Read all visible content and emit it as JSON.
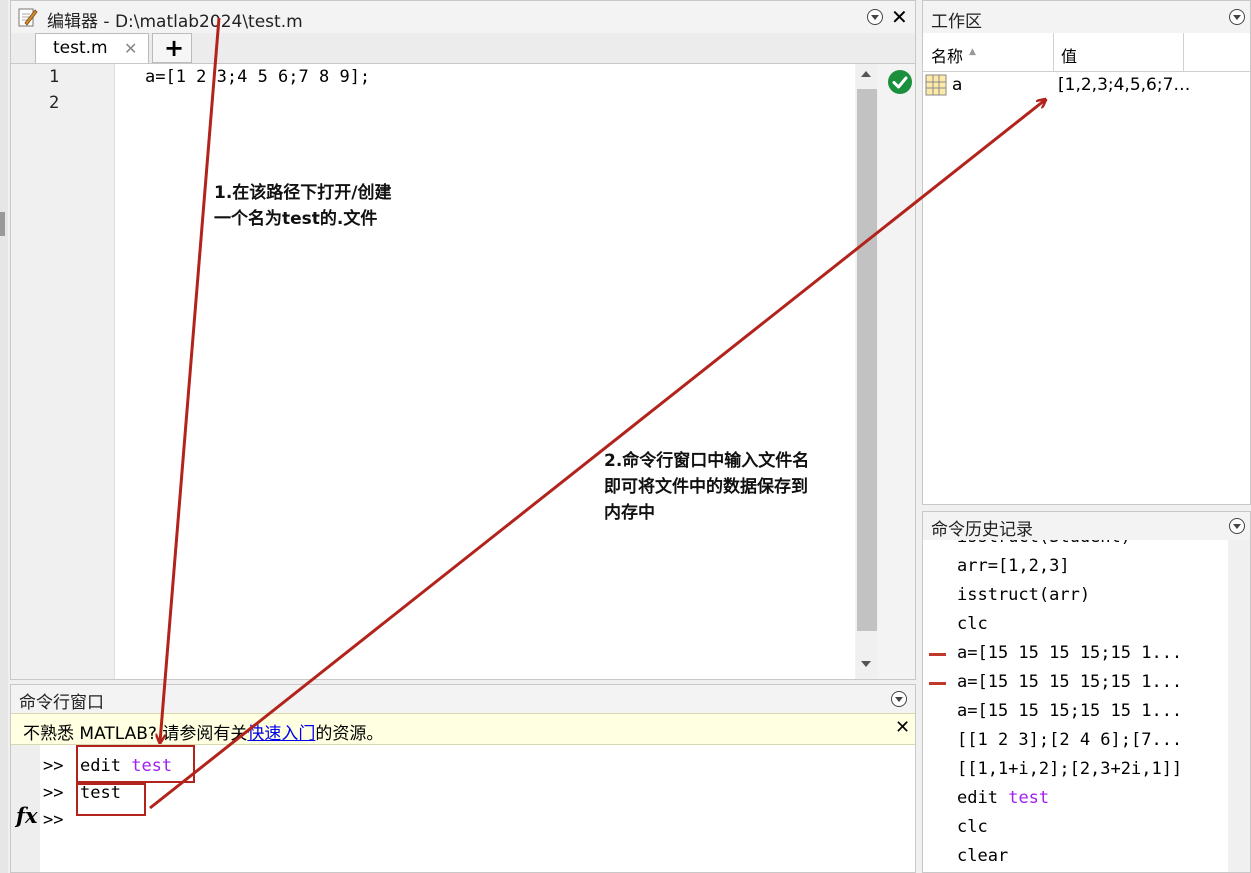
{
  "editor": {
    "title": "编辑器 - D:\\matlab2024\\test.m",
    "tab_label": "test.m",
    "line_numbers": [
      "1",
      "2"
    ],
    "code_line_1": "a=[1 2 3;4 5 6;7 8 9];",
    "add_tab_symbol": "+",
    "close_tab_symbol": "✕",
    "close_window_symbol": "✕"
  },
  "workspace": {
    "title": "工作区",
    "col_name": "名称",
    "col_value": "值",
    "sort_indicator": "▲",
    "variables": [
      {
        "name": "a",
        "value": "[1,2,3;4,5,6;7…"
      }
    ]
  },
  "command_window": {
    "title": "命令行窗口",
    "notice_prefix": "不熟悉 MATLAB? 请参阅有关",
    "notice_link": "快速入门",
    "notice_suffix": "的资源。",
    "prompt": ">>",
    "line1_cmd": "edit",
    "line1_arg": "test",
    "line2_cmd": "test",
    "fx_label": "fx",
    "close_symbol": "✕"
  },
  "history": {
    "title": "命令历史记录",
    "items": [
      {
        "text": "isstruct(Student)"
      },
      {
        "text": "arr=[1,2,3]"
      },
      {
        "text": "isstruct(arr)"
      },
      {
        "text": "clc"
      },
      {
        "text": "a=[15 15 15 15;15 1..."
      },
      {
        "text": "a=[15 15 15 15;15 1..."
      },
      {
        "text": "a=[15 15 15;15 15 1..."
      },
      {
        "text": "[[1 2 3];[2 4 6];[7..."
      },
      {
        "text": "[[1,1+i,2];[2,3+2i,1]]"
      },
      {
        "text": "edit",
        "arg": "test"
      },
      {
        "text": "clc"
      },
      {
        "text": "clear"
      }
    ]
  },
  "annotations": {
    "note1_line1": "1.在该路径下打开/创建",
    "note1_line2": "一个名为test的.文件",
    "note2_line1": "2.命令行窗口中输入文件名",
    "note2_line2": "即可将文件中的数据保存到",
    "note2_line3": "内存中"
  },
  "colors": {
    "arrow": "#b2231c",
    "link": "#0000ee",
    "string_arg": "#a020f0",
    "check": "#1a8f3c",
    "notice_bg": "#ffffe1"
  }
}
